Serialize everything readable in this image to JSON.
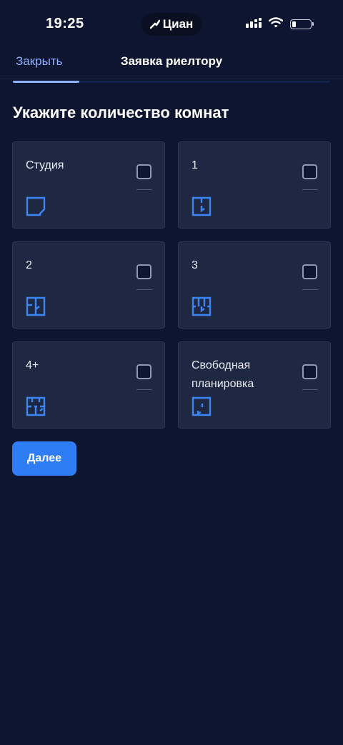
{
  "status_bar": {
    "time": "19:25",
    "app_badge": "Циан",
    "battery_level_fraction": 0.2
  },
  "header": {
    "close_label": "Закрыть",
    "title": "Заявка риелтору"
  },
  "progress": {
    "fraction": 0.21
  },
  "page": {
    "title": "Укажите количество комнат"
  },
  "options": [
    {
      "label": "Студия",
      "checked": false,
      "icon": "studio-floorplan-icon"
    },
    {
      "label": "1",
      "checked": false,
      "icon": "one-room-floorplan-icon"
    },
    {
      "label": "2",
      "checked": false,
      "icon": "two-room-floorplan-icon"
    },
    {
      "label": "3",
      "checked": false,
      "icon": "three-room-floorplan-icon"
    },
    {
      "label": "4+",
      "checked": false,
      "icon": "four-plus-room-floorplan-icon"
    },
    {
      "label": "Свободная планировка",
      "checked": false,
      "icon": "open-plan-floorplan-icon"
    }
  ],
  "actions": {
    "next_label": "Далее"
  },
  "colors": {
    "background": "#0e1530",
    "card": "#1f2843",
    "accent": "#2e7df4",
    "link": "#8fb1ff"
  }
}
